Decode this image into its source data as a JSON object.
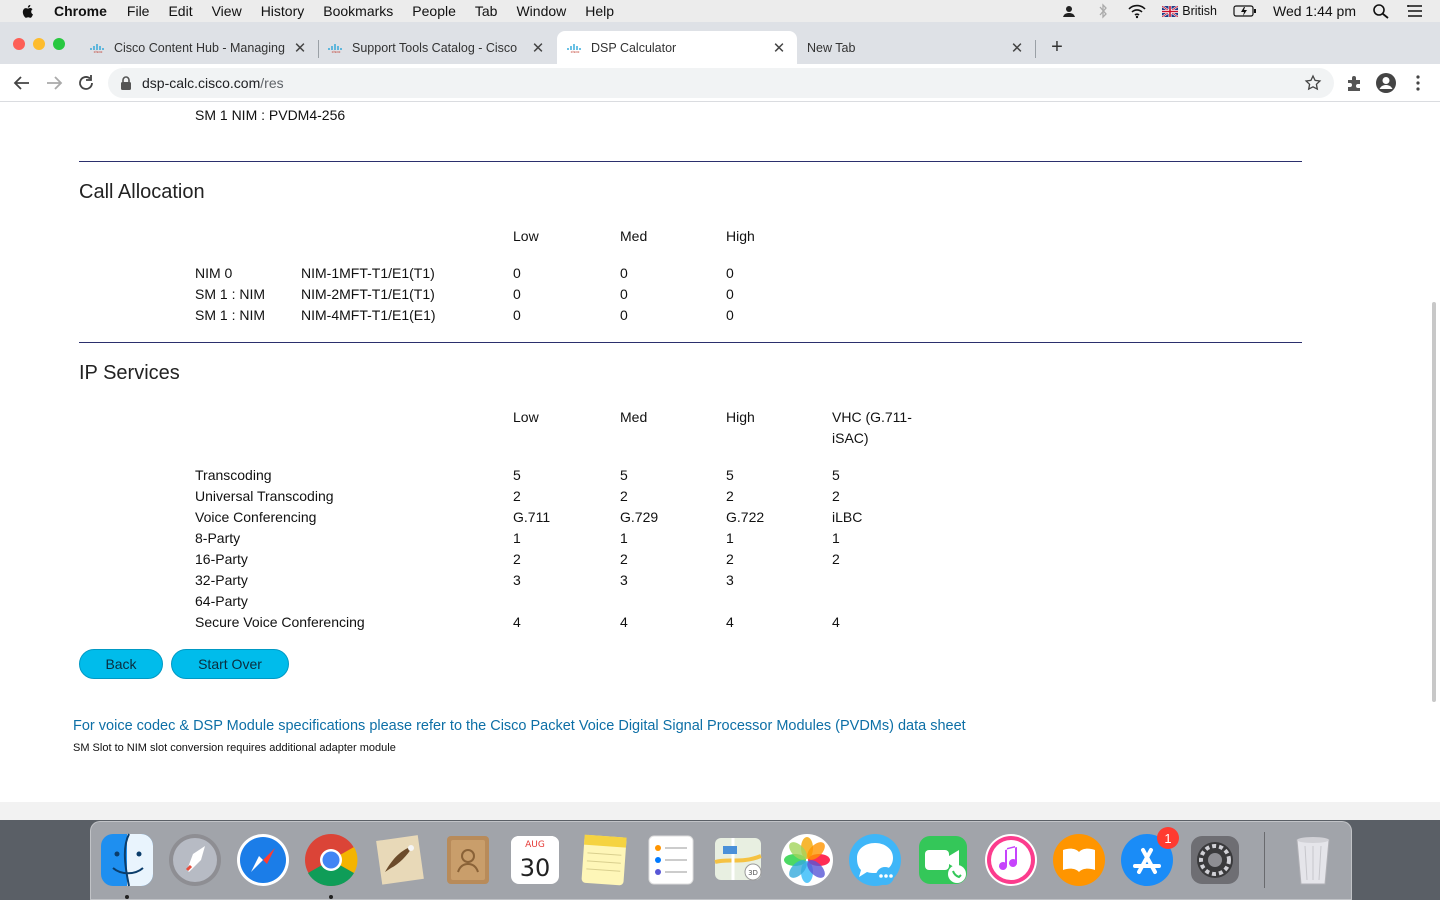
{
  "menubar": {
    "items": [
      "Chrome",
      "File",
      "Edit",
      "View",
      "History",
      "Bookmarks",
      "People",
      "Tab",
      "Window",
      "Help"
    ],
    "input_source": "British",
    "clock": "Wed 1:44 pm"
  },
  "tabs": [
    {
      "title": "Cisco Content Hub - Managing",
      "active": false
    },
    {
      "title": "Support Tools Catalog - Cisco",
      "active": false
    },
    {
      "title": "DSP Calculator",
      "active": true
    },
    {
      "title": "New Tab",
      "active": false
    }
  ],
  "address_bar": {
    "host": "dsp-calc.cisco.com",
    "path": "/res"
  },
  "page": {
    "top_line": "SM 1 NIM : PVDM4-256",
    "call_allocation": {
      "title": "Call Allocation",
      "headers": [
        "Low",
        "Med",
        "High"
      ],
      "rows": [
        {
          "slot": "NIM 0",
          "module": "NIM-1MFT-T1/E1(T1)",
          "low": "0",
          "med": "0",
          "high": "0"
        },
        {
          "slot": "SM 1 : NIM",
          "module": "NIM-2MFT-T1/E1(T1)",
          "low": "0",
          "med": "0",
          "high": "0"
        },
        {
          "slot": "SM 1 : NIM",
          "module": "NIM-4MFT-T1/E1(E1)",
          "low": "0",
          "med": "0",
          "high": "0"
        }
      ]
    },
    "ip_services": {
      "title": "IP Services",
      "headers": [
        "Low",
        "Med",
        "High",
        "VHC (G.711-",
        "iSAC)"
      ],
      "rows": [
        {
          "label": "Transcoding",
          "low": "5",
          "med": "5",
          "high": "5",
          "vhc": "5"
        },
        {
          "label": "Universal Transcoding",
          "low": "2",
          "med": "2",
          "high": "2",
          "vhc": "2"
        },
        {
          "label": "Voice Conferencing",
          "low": "G.711",
          "med": "G.729",
          "high": "G.722",
          "vhc": "iLBC"
        },
        {
          "label": "8-Party",
          "low": "1",
          "med": "1",
          "high": "1",
          "vhc": "1"
        },
        {
          "label": "16-Party",
          "low": "2",
          "med": "2",
          "high": "2",
          "vhc": "2"
        },
        {
          "label": "32-Party",
          "low": "3",
          "med": "3",
          "high": "3",
          "vhc": ""
        },
        {
          "label": "64-Party",
          "low": "",
          "med": "",
          "high": "",
          "vhc": ""
        },
        {
          "label": "Secure Voice Conferencing",
          "low": "4",
          "med": "4",
          "high": "4",
          "vhc": "4"
        }
      ]
    },
    "buttons": {
      "back": "Back",
      "start_over": "Start Over"
    },
    "pvdm_link": "For voice codec & DSP Module specifications please refer to the Cisco Packet Voice Digital Signal Processor Modules (PVDMs) data sheet",
    "sm_note": "SM Slot to NIM slot conversion requires additional adapter module"
  },
  "dock": {
    "calendar_month": "AUG",
    "calendar_day": "30",
    "app_store_badge": "1",
    "apps": [
      "finder-icon",
      "launchpad-icon",
      "safari-icon",
      "chrome-icon",
      "mail-icon",
      "contacts-icon",
      "calendar-icon",
      "notes-icon",
      "reminders-icon",
      "maps-icon",
      "photos-icon",
      "messages-icon",
      "facetime-icon",
      "itunes-icon",
      "books-icon",
      "app-store-icon",
      "system-preferences-icon",
      "trash-icon"
    ]
  },
  "colors": {
    "accent_button": "#00bceb",
    "rule": "#2b2f6d",
    "link": "#0d6fa6"
  }
}
